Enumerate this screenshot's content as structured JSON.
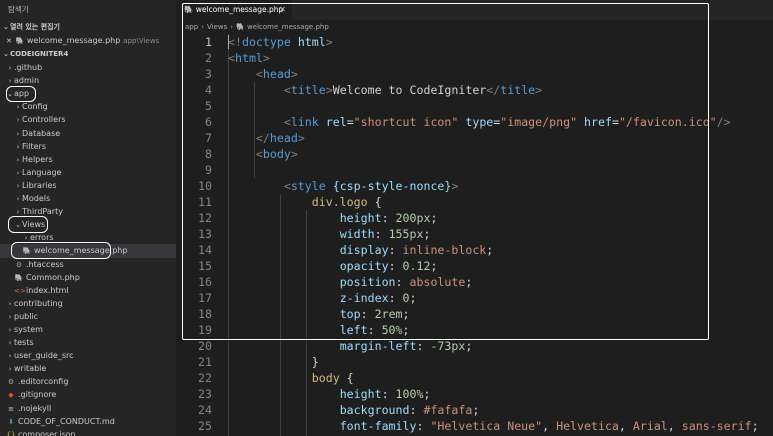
{
  "explorer": {
    "title": "탐색기",
    "open_editors_label": "열려 있는 편집기",
    "open_editor": {
      "close": "✕",
      "name": "welcome_message.php",
      "path": "app\\Views"
    },
    "project_label": "CODEIGNITER4",
    "tree": [
      {
        "name": ".github",
        "depth": 0,
        "kind": "folder"
      },
      {
        "name": "admin",
        "depth": 0,
        "kind": "folder"
      },
      {
        "name": "app",
        "depth": 0,
        "kind": "folder-open"
      },
      {
        "name": "Config",
        "depth": 1,
        "kind": "folder"
      },
      {
        "name": "Controllers",
        "depth": 1,
        "kind": "folder"
      },
      {
        "name": "Database",
        "depth": 1,
        "kind": "folder"
      },
      {
        "name": "Filters",
        "depth": 1,
        "kind": "folder"
      },
      {
        "name": "Helpers",
        "depth": 1,
        "kind": "folder"
      },
      {
        "name": "Language",
        "depth": 1,
        "kind": "folder"
      },
      {
        "name": "Libraries",
        "depth": 1,
        "kind": "folder"
      },
      {
        "name": "Models",
        "depth": 1,
        "kind": "folder"
      },
      {
        "name": "ThirdParty",
        "depth": 1,
        "kind": "folder"
      },
      {
        "name": "Views",
        "depth": 1,
        "kind": "folder-open"
      },
      {
        "name": "errors",
        "depth": 2,
        "kind": "folder"
      },
      {
        "name": "welcome_message.php",
        "depth": 2,
        "kind": "php",
        "selected": true
      },
      {
        "name": ".htaccess",
        "depth": 1,
        "kind": "gear"
      },
      {
        "name": "Common.php",
        "depth": 1,
        "kind": "php"
      },
      {
        "name": "index.html",
        "depth": 1,
        "kind": "html"
      },
      {
        "name": "contributing",
        "depth": 0,
        "kind": "folder"
      },
      {
        "name": "public",
        "depth": 0,
        "kind": "folder"
      },
      {
        "name": "system",
        "depth": 0,
        "kind": "folder"
      },
      {
        "name": "tests",
        "depth": 0,
        "kind": "folder"
      },
      {
        "name": "user_guide_src",
        "depth": 0,
        "kind": "folder"
      },
      {
        "name": "writable",
        "depth": 0,
        "kind": "folder"
      },
      {
        "name": ".editorconfig",
        "depth": 0,
        "kind": "gear"
      },
      {
        "name": ".gitignore",
        "depth": 0,
        "kind": "git"
      },
      {
        "name": ".nojekyll",
        "depth": 0,
        "kind": "file"
      },
      {
        "name": "CODE_OF_CONDUCT.md",
        "depth": 0,
        "kind": "md"
      },
      {
        "name": "composer.json",
        "depth": 0,
        "kind": "json"
      }
    ]
  },
  "tab": {
    "label": "welcome_message.php",
    "close": "✕"
  },
  "breadcrumb": [
    "app",
    "Views",
    "welcome_message.php"
  ],
  "code_lines": [
    {
      "n": "1",
      "tokens": [
        [
          "punct",
          "<!"
        ],
        [
          "tag",
          "doctype"
        ],
        [
          "text",
          " "
        ],
        [
          "attr",
          "html"
        ],
        [
          "punct",
          ">"
        ]
      ]
    },
    {
      "n": "2",
      "tokens": [
        [
          "punct",
          "<"
        ],
        [
          "tag",
          "html"
        ],
        [
          "punct",
          ">"
        ]
      ]
    },
    {
      "n": "3",
      "tokens": [
        [
          "text",
          "    "
        ],
        [
          "punct",
          "<"
        ],
        [
          "tag",
          "head"
        ],
        [
          "punct",
          ">"
        ]
      ]
    },
    {
      "n": "4",
      "tokens": [
        [
          "text",
          "        "
        ],
        [
          "punct",
          "<"
        ],
        [
          "tag",
          "title"
        ],
        [
          "punct",
          ">"
        ],
        [
          "text",
          "Welcome to CodeIgniter"
        ],
        [
          "punct",
          "</"
        ],
        [
          "tag",
          "title"
        ],
        [
          "punct",
          ">"
        ]
      ]
    },
    {
      "n": "5",
      "tokens": []
    },
    {
      "n": "6",
      "tokens": [
        [
          "text",
          "        "
        ],
        [
          "punct",
          "<"
        ],
        [
          "tag",
          "link"
        ],
        [
          "text",
          " "
        ],
        [
          "attr",
          "rel"
        ],
        [
          "text",
          "="
        ],
        [
          "str",
          "\"shortcut icon\""
        ],
        [
          "text",
          " "
        ],
        [
          "attr",
          "type"
        ],
        [
          "text",
          "="
        ],
        [
          "str",
          "\"image/png\""
        ],
        [
          "text",
          " "
        ],
        [
          "attr",
          "href"
        ],
        [
          "text",
          "="
        ],
        [
          "str",
          "\"/favicon.ico\""
        ],
        [
          "punct",
          "/>"
        ]
      ]
    },
    {
      "n": "7",
      "tokens": [
        [
          "text",
          "    "
        ],
        [
          "punct",
          "</"
        ],
        [
          "tag",
          "head"
        ],
        [
          "punct",
          ">"
        ]
      ]
    },
    {
      "n": "8",
      "tokens": [
        [
          "text",
          "    "
        ],
        [
          "punct",
          "<"
        ],
        [
          "tag",
          "body"
        ],
        [
          "punct",
          ">"
        ]
      ]
    },
    {
      "n": "9",
      "tokens": []
    },
    {
      "n": "10",
      "tokens": [
        [
          "text",
          "        "
        ],
        [
          "punct",
          "<"
        ],
        [
          "tag",
          "style"
        ],
        [
          "text",
          " "
        ],
        [
          "attr",
          "{csp-style-nonce}"
        ],
        [
          "punct",
          ">"
        ]
      ]
    },
    {
      "n": "11",
      "tokens": [
        [
          "text",
          "            "
        ],
        [
          "sel",
          "div.logo"
        ],
        [
          "text",
          " {"
        ]
      ]
    },
    {
      "n": "12",
      "tokens": [
        [
          "text",
          "                "
        ],
        [
          "attr",
          "height"
        ],
        [
          "text",
          ": "
        ],
        [
          "num",
          "200px"
        ],
        [
          "text",
          ";"
        ]
      ]
    },
    {
      "n": "13",
      "tokens": [
        [
          "text",
          "                "
        ],
        [
          "attr",
          "width"
        ],
        [
          "text",
          ": "
        ],
        [
          "num",
          "155px"
        ],
        [
          "text",
          ";"
        ]
      ]
    },
    {
      "n": "14",
      "tokens": [
        [
          "text",
          "                "
        ],
        [
          "attr",
          "display"
        ],
        [
          "text",
          ": "
        ],
        [
          "str",
          "inline-block"
        ],
        [
          "text",
          ";"
        ]
      ]
    },
    {
      "n": "15",
      "tokens": [
        [
          "text",
          "                "
        ],
        [
          "attr",
          "opacity"
        ],
        [
          "text",
          ": "
        ],
        [
          "num",
          "0.12"
        ],
        [
          "text",
          ";"
        ]
      ]
    },
    {
      "n": "16",
      "tokens": [
        [
          "text",
          "                "
        ],
        [
          "attr",
          "position"
        ],
        [
          "text",
          ": "
        ],
        [
          "str",
          "absolute"
        ],
        [
          "text",
          ";"
        ]
      ]
    },
    {
      "n": "17",
      "tokens": [
        [
          "text",
          "                "
        ],
        [
          "attr",
          "z-index"
        ],
        [
          "text",
          ": "
        ],
        [
          "num",
          "0"
        ],
        [
          "text",
          ";"
        ]
      ]
    },
    {
      "n": "18",
      "tokens": [
        [
          "text",
          "                "
        ],
        [
          "attr",
          "top"
        ],
        [
          "text",
          ": "
        ],
        [
          "num",
          "2rem"
        ],
        [
          "text",
          ";"
        ]
      ]
    },
    {
      "n": "19",
      "tokens": [
        [
          "text",
          "                "
        ],
        [
          "attr",
          "left"
        ],
        [
          "text",
          ": "
        ],
        [
          "num",
          "50%"
        ],
        [
          "text",
          ";"
        ]
      ]
    },
    {
      "n": "20",
      "tokens": [
        [
          "text",
          "                "
        ],
        [
          "attr",
          "margin-left"
        ],
        [
          "text",
          ": "
        ],
        [
          "num",
          "-73px"
        ],
        [
          "text",
          ";"
        ]
      ]
    },
    {
      "n": "21",
      "tokens": [
        [
          "text",
          "            }"
        ]
      ]
    },
    {
      "n": "22",
      "tokens": [
        [
          "text",
          "            "
        ],
        [
          "sel",
          "body"
        ],
        [
          "text",
          " {"
        ]
      ]
    },
    {
      "n": "23",
      "tokens": [
        [
          "text",
          "                "
        ],
        [
          "attr",
          "height"
        ],
        [
          "text",
          ": "
        ],
        [
          "num",
          "100%"
        ],
        [
          "text",
          ";"
        ]
      ]
    },
    {
      "n": "24",
      "tokens": [
        [
          "text",
          "                "
        ],
        [
          "attr",
          "background"
        ],
        [
          "text",
          ": "
        ],
        [
          "str",
          "#fafafa"
        ],
        [
          "text",
          ";"
        ]
      ]
    },
    {
      "n": "25",
      "tokens": [
        [
          "text",
          "                "
        ],
        [
          "attr",
          "font-family"
        ],
        [
          "text",
          ": "
        ],
        [
          "str",
          "\"Helvetica Neue\""
        ],
        [
          "text",
          ", "
        ],
        [
          "str",
          "Helvetica"
        ],
        [
          "text",
          ", "
        ],
        [
          "str",
          "Arial"
        ],
        [
          "text",
          ", "
        ],
        [
          "str",
          "sans-serif"
        ],
        [
          "text",
          ";"
        ]
      ]
    }
  ]
}
